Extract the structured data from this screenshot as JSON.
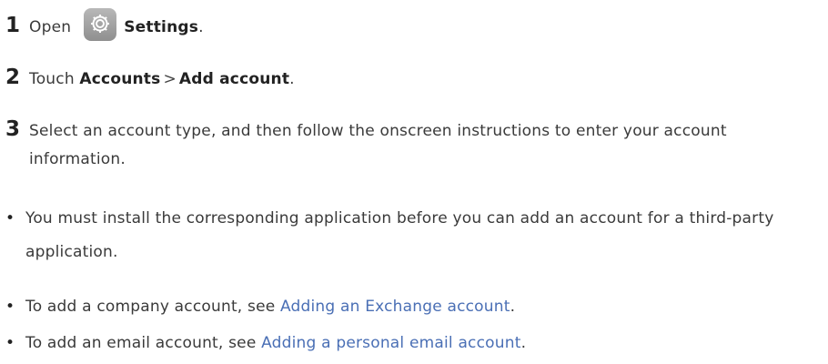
{
  "steps": [
    {
      "number": "1",
      "prefix": "Open",
      "icon": "settings-gear-icon",
      "target": "Settings",
      "suffix": "."
    },
    {
      "number": "2",
      "prefix": "Touch",
      "path_first": "Accounts",
      "separator": ">",
      "path_second": "Add account",
      "suffix": "."
    },
    {
      "number": "3",
      "text": "Select an account type, and then follow the onscreen instructions to enter your account information."
    }
  ],
  "notes": [
    {
      "bullet": "•",
      "text": "You must install the corresponding application before you can add an account for a third-party application."
    },
    {
      "bullet": "•",
      "text": "To add a company account, see",
      "link": "Adding an Exchange account",
      "suffix": "."
    },
    {
      "bullet": "•",
      "text": "To add an email account, see",
      "link": "Adding a personal email account",
      "suffix": "."
    }
  ],
  "colors": {
    "link": "#4a6fb5",
    "text": "#3a3a3a",
    "icon_bg": "#a0a0a0"
  }
}
